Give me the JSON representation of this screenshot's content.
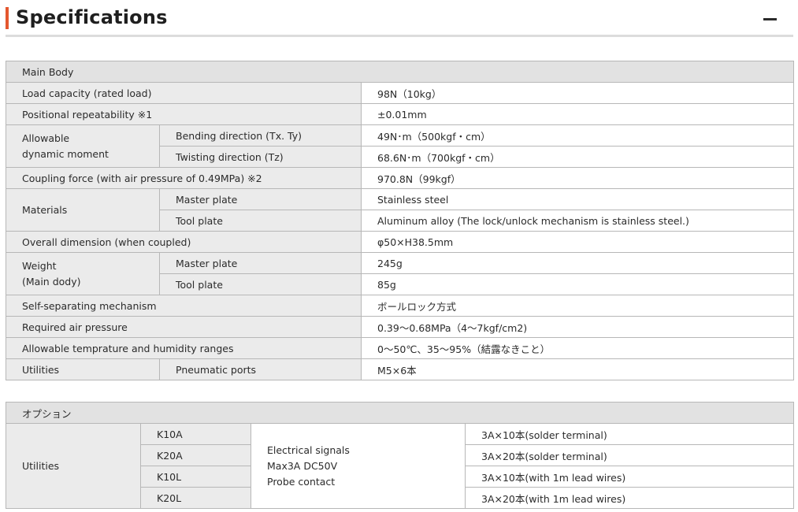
{
  "header": {
    "title": "Specifications",
    "collapse_icon": "minus-icon"
  },
  "main_table": {
    "section": "Main Body",
    "load_capacity": {
      "label": "Load capacity (rated load)",
      "value": "98N（10kg）"
    },
    "repeatability": {
      "label": "Positional repeatability ※1",
      "value": "±0.01mm"
    },
    "dynamic_moment": {
      "label_line1": "Allowable",
      "label_line2": "dynamic moment",
      "bending": {
        "label": "Bending direction (Tx. Ty)",
        "value": "49N･m（500kgf・cm）"
      },
      "twisting": {
        "label": "Twisting direction (Tz)",
        "value": "68.6N･m（700kgf・cm）"
      }
    },
    "coupling_force": {
      "label": "Coupling force (with air pressure of 0.49MPa) ※2",
      "value": "970.8N（99kgf）"
    },
    "materials": {
      "label": "Materials",
      "master": {
        "label": "Master plate",
        "value": "Stainless steel"
      },
      "tool": {
        "label": "Tool plate",
        "value": "Aluminum alloy (The lock/unlock mechanism is stainless steel.)"
      }
    },
    "overall_dimension": {
      "label": "Overall dimension (when coupled)",
      "value": "φ50×H38.5mm"
    },
    "weight": {
      "label_line1": "Weight",
      "label_line2": "(Main dody)",
      "master": {
        "label": "Master plate",
        "value": "245g"
      },
      "tool": {
        "label": "Tool plate",
        "value": "85g"
      }
    },
    "self_separating": {
      "label": "Self-separating mechanism",
      "value": "ボールロック方式"
    },
    "air_pressure": {
      "label": "Required air pressure",
      "value": "0.39～0.68MPa（4～7kgf/cm2)"
    },
    "temp_humidity": {
      "label": "Allowable temprature and humidity ranges",
      "value": "0～50℃、35～95%（結露なきこと）"
    },
    "utilities": {
      "label": "Utilities",
      "sub_label": "Pneumatic ports",
      "value": "M5×6本"
    }
  },
  "options_table": {
    "section": "オプション",
    "utilities_label": "Utilities",
    "signal_line1": "Electrical signals",
    "signal_line2": "Max3A DC50V",
    "signal_line3": "Probe contact",
    "rows": [
      {
        "model": "K10A",
        "value": "3A×10本(solder terminal)"
      },
      {
        "model": "K20A",
        "value": "3A×20本(solder terminal)"
      },
      {
        "model": "K10L",
        "value": "3A×10本(with 1m lead wires)"
      },
      {
        "model": "K20L",
        "value": "3A×20本(with 1m lead wires)"
      }
    ]
  }
}
